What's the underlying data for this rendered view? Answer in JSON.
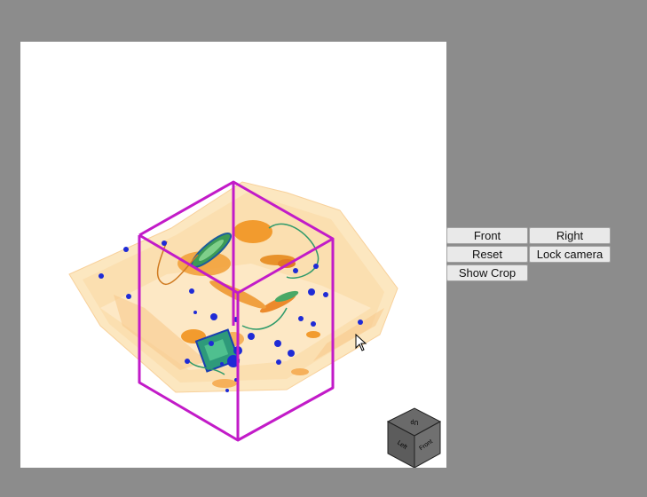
{
  "buttons": {
    "front": "Front",
    "right": "Right",
    "reset": "Reset",
    "lock_camera": "Lock camera",
    "show_crop": "Show Crop"
  },
  "orientation_cube": {
    "top": "Up",
    "left": "Left",
    "front": "Front"
  },
  "colors": {
    "background": "#8c8c8c",
    "viewport": "#ffffff",
    "crop_box": "#c21bc8",
    "volume_light": "#fbd9a0",
    "volume_orange": "#f29b2e",
    "volume_green": "#49a860",
    "volume_blue": "#1f2bd6"
  },
  "icons": {
    "cursor": "arrow-cursor-icon",
    "cube": "orientation-cube-icon"
  }
}
